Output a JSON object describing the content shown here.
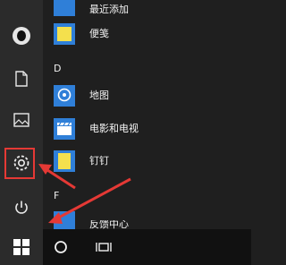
{
  "start_menu": {
    "apps": [
      {
        "label": "最近添加",
        "icon": "recent-icon"
      },
      {
        "label": "便笺",
        "icon": "sticky-notes-icon"
      },
      {
        "label": "地图",
        "icon": "maps-icon"
      },
      {
        "label": "电影和电视",
        "icon": "movies-tv-icon"
      },
      {
        "label": "钉钉",
        "icon": "dingtalk-icon"
      },
      {
        "label": "反馈中心",
        "icon": "feedback-hub-icon"
      }
    ],
    "letters": {
      "d": "D",
      "f": "F"
    }
  },
  "annotation_color": "#e53935"
}
